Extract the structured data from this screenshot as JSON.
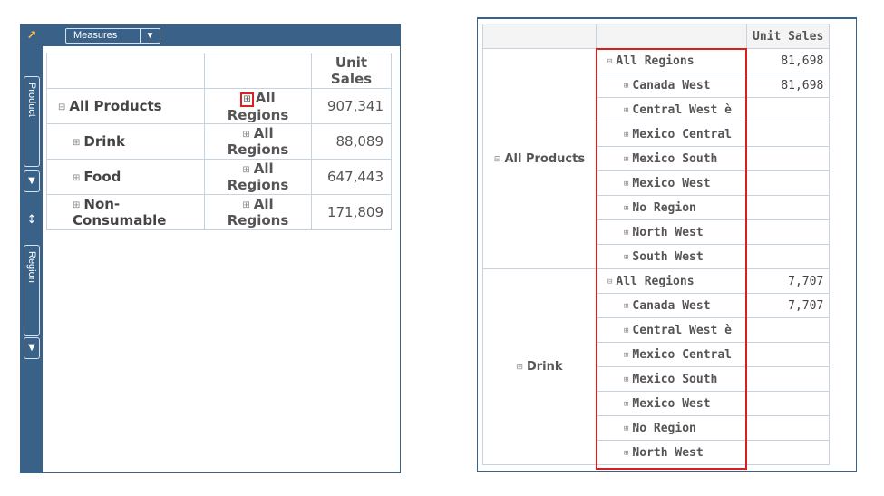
{
  "left": {
    "measures_label": "Measures",
    "filter_icon": "▼",
    "corner_icon": "↗",
    "side_tabs": [
      "Product",
      "Region"
    ],
    "swap_icon": "↕",
    "header": "Unit Sales",
    "rows": [
      {
        "expander": "⊟",
        "product": "All Products",
        "region_expander": "⊞",
        "region": "All Regions",
        "value": "907,341"
      },
      {
        "expander": "⊞",
        "product": "Drink",
        "region_expander": "⊞",
        "region": "All Regions",
        "value": "88,089"
      },
      {
        "expander": "⊞",
        "product": "Food",
        "region_expander": "⊞",
        "region": "All Regions",
        "value": "647,443"
      },
      {
        "expander": "⊞",
        "product": "Non-Consumable",
        "region_expander": "⊞",
        "region": "All Regions",
        "value": "171,809"
      }
    ]
  },
  "right": {
    "header": "Unit Sales",
    "groups": [
      {
        "expander": "⊟",
        "product": "All Products",
        "rows": [
          {
            "expander": "⊟",
            "region": "All Regions",
            "value": "81,698"
          },
          {
            "expander": "⊞",
            "region": "Canada West",
            "value": "81,698"
          },
          {
            "expander": "⊞",
            "region": "Central West è",
            "value": ""
          },
          {
            "expander": "⊞",
            "region": "Mexico Central",
            "value": ""
          },
          {
            "expander": "⊞",
            "region": "Mexico South",
            "value": ""
          },
          {
            "expander": "⊞",
            "region": "Mexico West",
            "value": ""
          },
          {
            "expander": "⊞",
            "region": "No Region",
            "value": ""
          },
          {
            "expander": "⊞",
            "region": "North West",
            "value": ""
          },
          {
            "expander": "⊞",
            "region": "South West",
            "value": ""
          }
        ]
      },
      {
        "expander": "⊞",
        "product": "Drink",
        "rows": [
          {
            "expander": "⊟",
            "region": "All Regions",
            "value": "7,707"
          },
          {
            "expander": "⊞",
            "region": "Canada West",
            "value": "7,707"
          },
          {
            "expander": "⊞",
            "region": "Central West è",
            "value": ""
          },
          {
            "expander": "⊞",
            "region": "Mexico Central",
            "value": ""
          },
          {
            "expander": "⊞",
            "region": "Mexico South",
            "value": ""
          },
          {
            "expander": "⊞",
            "region": "Mexico West",
            "value": ""
          },
          {
            "expander": "⊞",
            "region": "No Region",
            "value": ""
          },
          {
            "expander": "⊞",
            "region": "North West",
            "value": ""
          }
        ]
      }
    ]
  },
  "colors": {
    "panel_blue": "#3a6289",
    "highlight_red": "#d81e1e",
    "corner_icon": "#f5c243"
  }
}
